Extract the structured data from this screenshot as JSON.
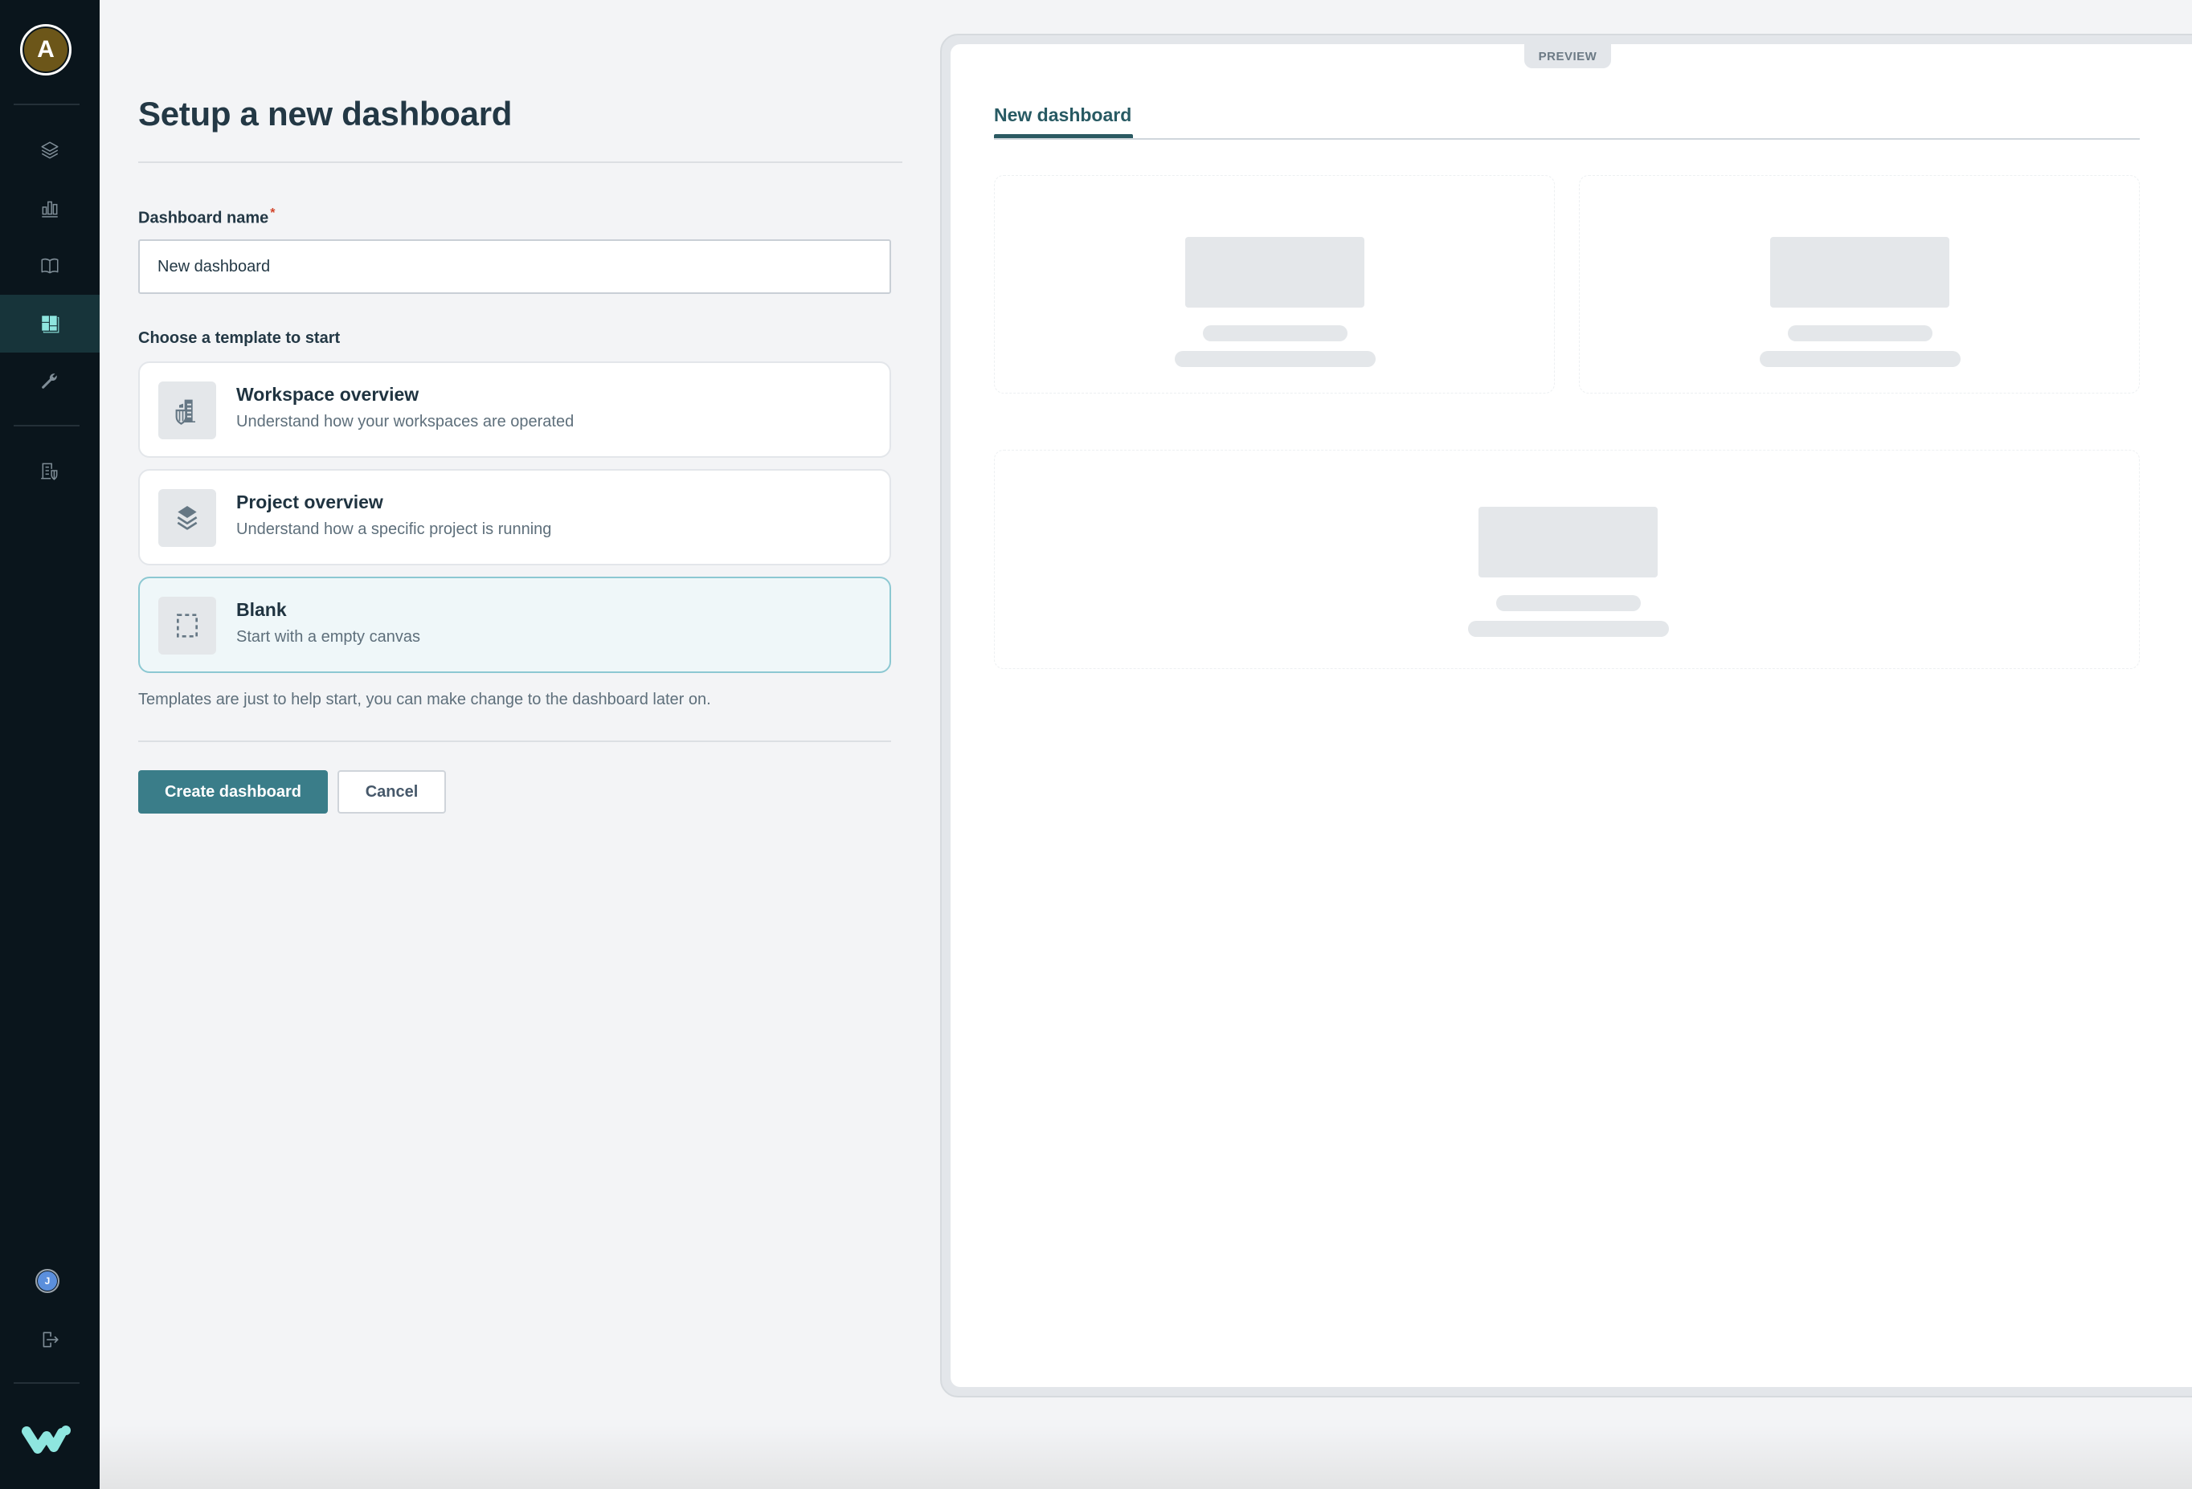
{
  "sidebar": {
    "avatar_initial": "A",
    "user_initial": "J",
    "items": [
      {
        "name": "projects",
        "icon": "layers-icon",
        "active": false
      },
      {
        "name": "analytics",
        "icon": "bar-chart-icon",
        "active": false
      },
      {
        "name": "docs",
        "icon": "book-icon",
        "active": false
      },
      {
        "name": "dashboards",
        "icon": "dashboard-icon",
        "active": true
      },
      {
        "name": "tools",
        "icon": "wrench-icon",
        "active": false
      },
      {
        "name": "workspace",
        "icon": "building-shield-icon",
        "active": false
      }
    ],
    "footer": [
      {
        "name": "user-avatar",
        "icon": "avatar-icon"
      },
      {
        "name": "logout",
        "icon": "logout-icon"
      },
      {
        "name": "brand-logo",
        "icon": "w-logo-icon"
      }
    ],
    "colors": {
      "background": "#0a151c",
      "active_bg": "#17343a",
      "accent": "#8ee6df"
    }
  },
  "form": {
    "title": "Setup a new dashboard",
    "name_label": "Dashboard name",
    "required_marker": "*",
    "name_value": "New dashboard",
    "template_label": "Choose a template to start",
    "templates": [
      {
        "title": "Workspace overview",
        "description": "Understand how your workspaces are operated",
        "icon": "building-shield-icon",
        "selected": false
      },
      {
        "title": "Project overview",
        "description": "Understand how a specific project is running",
        "icon": "layers-icon",
        "selected": false
      },
      {
        "title": "Blank",
        "description": "Start with a empty canvas",
        "icon": "dashed-square-icon",
        "selected": true
      }
    ],
    "note": "Templates are just to help start, you can make change to the dashboard later on.",
    "create_label": "Create dashboard",
    "cancel_label": "Cancel",
    "colors": {
      "primary": "#3a7d89",
      "selected_card_bg": "#eff7f9",
      "selected_card_border": "#8cc8d2"
    }
  },
  "preview": {
    "tag": "PREVIEW",
    "tab_label": "New dashboard",
    "placeholder_widgets": 3
  }
}
